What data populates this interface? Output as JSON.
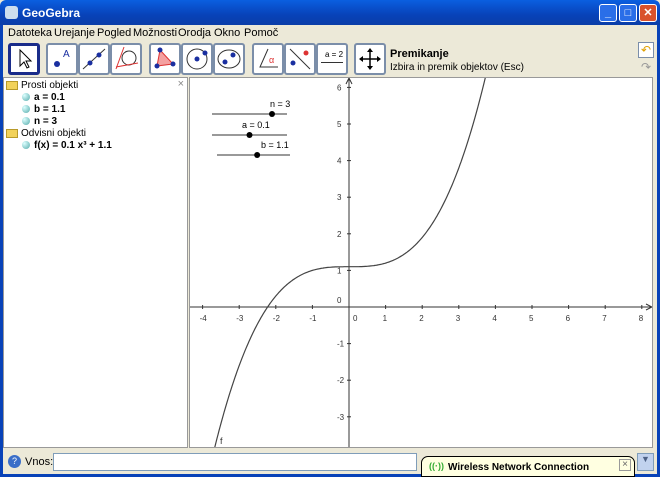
{
  "window": {
    "title": "GeoGebra"
  },
  "menu": [
    "Datoteka",
    "Urejanje",
    "Pogled",
    "Možnosti",
    "Orodja",
    "Okno",
    "Pomoč"
  ],
  "toolbar": {
    "tools": [
      "move",
      "point",
      "line",
      "perpendicular",
      "polygon",
      "circle",
      "conic",
      "angle",
      "reflect",
      "slider",
      "move-graphics-view"
    ],
    "slider_icon_label": "a = 2",
    "active_tool_name": "Premikanje",
    "active_tool_desc": "Izbira in premik objektov (Esc)"
  },
  "algebra": {
    "free_header": "Prosti objekti",
    "free": [
      "a = 0.1",
      "b = 1.1",
      "n = 3"
    ],
    "dependent_header": "Odvisni objekti",
    "dependent": [
      "f(x) = 0.1 x³ + 1.1"
    ]
  },
  "graphics": {
    "sliders": [
      {
        "label": "n = 3",
        "fraction": 0.8
      },
      {
        "label": "a = 0.1",
        "fraction": 0.5
      },
      {
        "label": "b = 1.1",
        "fraction": 0.55
      }
    ],
    "function_label": "f",
    "function": {
      "a": 0.1,
      "n": 3,
      "b": 1.1
    },
    "x_ticks": [
      "-4",
      "-3",
      "-2",
      "-1",
      "0",
      "1",
      "2",
      "3",
      "4",
      "5",
      "6",
      "7",
      "8"
    ],
    "y_ticks": [
      "-3",
      "-2",
      "-1",
      "0",
      "1",
      "2",
      "3",
      "4",
      "5",
      "6"
    ]
  },
  "inputbar": {
    "label": "Vnos:",
    "value": ""
  },
  "notification": {
    "text": "Wireless Network Connection"
  }
}
